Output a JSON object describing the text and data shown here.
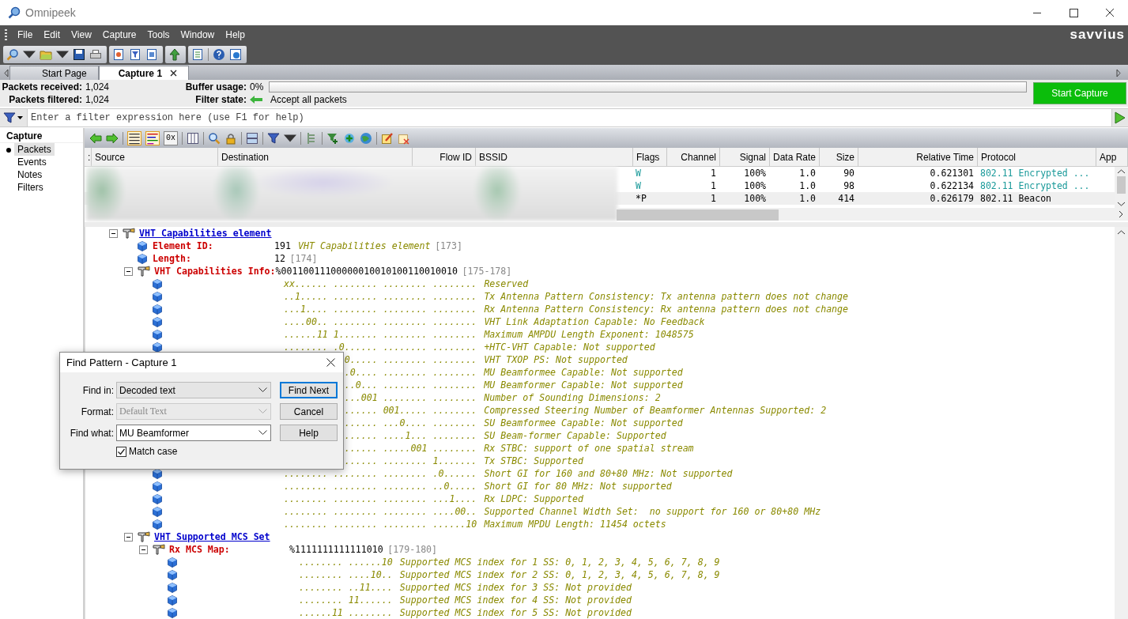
{
  "window": {
    "title": "Omnipeek"
  },
  "menu": [
    "File",
    "Edit",
    "View",
    "Capture",
    "Tools",
    "Window",
    "Help"
  ],
  "brand": "savvius",
  "tabs": [
    {
      "label": "Start Page",
      "selected": false,
      "closable": false
    },
    {
      "label": "Capture 1",
      "selected": true,
      "closable": true
    }
  ],
  "stats": {
    "received_label": "Packets received:",
    "received": "1,024",
    "filtered_label": "Packets filtered:",
    "filtered": "1,024",
    "buffer_label": "Buffer usage:",
    "buffer": "0%",
    "buffer_bar": {
      "level": 0
    },
    "filter_state_label": "Filter state:",
    "filter_state": "Accept all packets"
  },
  "start_button": "Start Capture",
  "filter": {
    "placeholder": "Enter a filter expression here (use F1 for help)"
  },
  "sidebar": {
    "title": "Capture",
    "items": [
      {
        "label": "Packets",
        "selected": true
      },
      {
        "label": "Events",
        "selected": false
      },
      {
        "label": "Notes",
        "selected": false
      },
      {
        "label": "Filters",
        "selected": false
      }
    ]
  },
  "view_buttons": [
    {
      "kind": "list",
      "selected": true
    },
    {
      "kind": "color_list",
      "selected": true
    },
    {
      "kind": "hex",
      "label": "0x",
      "selected": false
    }
  ],
  "packets": {
    "columns": [
      ":",
      "Source",
      "Destination",
      "Flow ID",
      "BSSID",
      "Flags",
      "Channel",
      "Signal",
      "Data Rate",
      "Size",
      "Relative Time",
      "Protocol",
      "App"
    ],
    "rows": [
      {
        "kind": "encrypted",
        "selected": false,
        "flags": "W",
        "channel": "1",
        "signal": "100%",
        "rate": "1.0",
        "size": "90",
        "time": "0.621301",
        "protocol": "802.11 Encrypted ..."
      },
      {
        "kind": "encrypted",
        "selected": false,
        "flags": "W",
        "channel": "1",
        "signal": "100%",
        "rate": "1.0",
        "size": "98",
        "time": "0.622134",
        "protocol": "802.11 Encrypted ..."
      },
      {
        "kind": "plain",
        "selected": true,
        "flags": "*P",
        "channel": "1",
        "signal": "100%",
        "rate": "1.0",
        "size": "414",
        "time": "0.626179",
        "protocol": "802.11 Beacon"
      }
    ]
  },
  "decode": [
    {
      "kind": "section",
      "label": "VHT Capabilities element",
      "expanded": true,
      "children": [
        {
          "kind": "field",
          "label": "Element ID:",
          "value": "191",
          "description": "VHT Capabilities element",
          "offset": "[173]"
        },
        {
          "kind": "field",
          "label": "Length:",
          "value": "12",
          "offset": "[174]"
        },
        {
          "kind": "group",
          "label": "VHT Capabilities Info:",
          "value": "%00110011100000010010100110010010",
          "offset": "[175-178]",
          "expanded": true,
          "children": [
            {
              "kind": "bit",
              "bits": "xx...... ........ ........ ........",
              "description": "Reserved"
            },
            {
              "kind": "bit",
              "bits": "..1..... ........ ........ ........",
              "description": "Tx Antenna Pattern Consistency: Tx antenna pattern does not change"
            },
            {
              "kind": "bit",
              "bits": "...1.... ........ ........ ........",
              "description": "Rx Antenna Pattern Consistency: Rx antenna pattern does not change"
            },
            {
              "kind": "bit",
              "bits": "....00.. ........ ........ ........",
              "description": "VHT Link Adaptation Capable: No Feedback"
            },
            {
              "kind": "bit",
              "bits": "......11 1....... ........ ........",
              "description": "Maximum AMPDU Length Exponent: 1048575"
            },
            {
              "kind": "bit",
              "bits": "........ .0...... ........ ........",
              "description": "+HTC-VHT Capable: Not supported"
            },
            {
              "kind": "bit_partial",
              "bits": "0..... ........ ........",
              "description": "VHT TXOP PS: Not supported"
            },
            {
              "kind": "bit_partial",
              "bits": ".0.... ........ ........",
              "description": "MU Beamformee Capable: Not supported"
            },
            {
              "kind": "bit_partial",
              "bits": "..0... ........ ........",
              "description": "MU Beamformer Capable: Not supported"
            },
            {
              "kind": "bit_partial",
              "bits": "...001 ........ ........",
              "description": "Number of Sounding Dimensions: 2"
            },
            {
              "kind": "bit_partial",
              "bits": "...... 001..... ........",
              "description": "Compressed Steering Number of Beamformer Antennas Supported: 2"
            },
            {
              "kind": "bit_partial",
              "bits": "...... ...0.... ........",
              "description": "SU Beamformee Capable: Not supported"
            },
            {
              "kind": "bit_partial",
              "bits": "...... ....1... ........",
              "description": "SU Beam-former Capable: Supported"
            },
            {
              "kind": "bit_partial",
              "bits": "...... .....001 ........",
              "description": "Rx STBC: support of one spatial stream"
            },
            {
              "kind": "bit_partial",
              "bits": "...... ........ 1.......",
              "description": "Tx STBC: Supported"
            },
            {
              "kind": "bit",
              "bits": "........ ........ ........ .0......",
              "description": "Short GI for 160 and 80+80 MHz: Not supported"
            },
            {
              "kind": "bit",
              "bits": "........ ........ ........ ..0.....",
              "description": "Short GI for 80 MHz: Not supported"
            },
            {
              "kind": "bit",
              "bits": "........ ........ ........ ...1....",
              "description": "Rx LDPC: Supported"
            },
            {
              "kind": "bit",
              "bits": "........ ........ ........ ....00..",
              "description": "Supported Channel Width Set:  no support for 160 or 80+80 MHz"
            },
            {
              "kind": "bit",
              "bits": "........ ........ ........ ......10",
              "description": "Maximum MPDU Length: 11454 octets"
            }
          ]
        },
        {
          "kind": "section",
          "label": "VHT Supported MCS Set",
          "expanded": true,
          "children": [
            {
              "kind": "group",
              "label": "Rx MCS Map:",
              "value": "%1111111111111010",
              "offset": "[179-180]",
              "expanded": true,
              "children": [
                {
                  "kind": "bit",
                  "bits": "........ ......10",
                  "description": "Supported MCS index for 1 SS: 0, 1, 2, 3, 4, 5, 6, 7, 8, 9"
                },
                {
                  "kind": "bit",
                  "bits": "........ ....10..",
                  "description": "Supported MCS index for 2 SS: 0, 1, 2, 3, 4, 5, 6, 7, 8, 9"
                },
                {
                  "kind": "bit",
                  "bits": "........ ..11....",
                  "description": "Supported MCS index for 3 SS: Not provided"
                },
                {
                  "kind": "bit",
                  "bits": "........ 11......",
                  "description": "Supported MCS index for 4 SS: Not provided"
                },
                {
                  "kind": "bit",
                  "bits": "......11 ........",
                  "description": "Supported MCS index for 5 SS: Not provided"
                }
              ]
            }
          ]
        }
      ]
    }
  ],
  "dialog": {
    "title": "Find Pattern - Capture 1",
    "fields": [
      {
        "kind": "dropdown",
        "label": "Find in:",
        "value": "Decoded text",
        "disabled": false
      },
      {
        "kind": "dropdown",
        "label": "Format:",
        "value": "Default Text",
        "disabled": true
      },
      {
        "kind": "combo",
        "label": "Find what:",
        "value": "MU Beamformer",
        "disabled": false
      }
    ],
    "match_case": {
      "label": "Match case",
      "checked": true
    },
    "buttons": [
      {
        "label": "Find Next",
        "default": true
      },
      {
        "label": "Cancel",
        "default": false
      },
      {
        "label": "Help",
        "default": false
      }
    ]
  }
}
